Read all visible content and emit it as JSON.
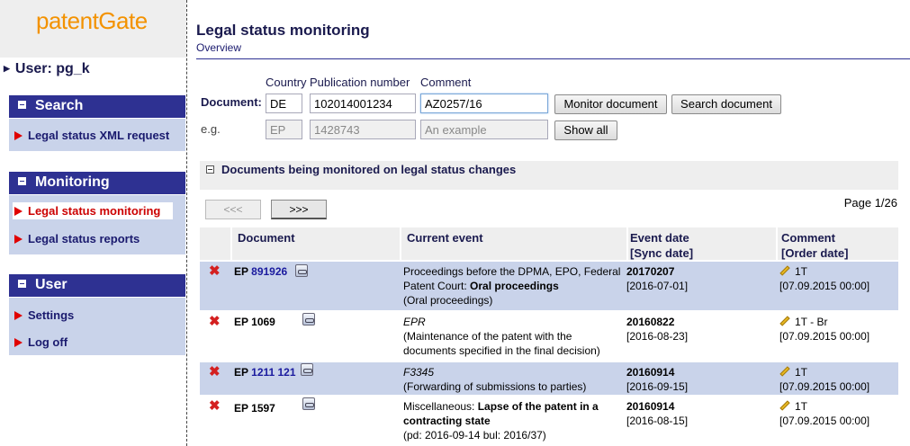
{
  "logo": "patentGate",
  "user_label": "User: pg_k",
  "sidebar": {
    "search": {
      "title": "Search",
      "items": [
        "Legal status XML request"
      ]
    },
    "monitoring": {
      "title": "Monitoring",
      "items": [
        "Legal status monitoring",
        "Legal status reports"
      ],
      "active": "Legal status monitoring"
    },
    "user": {
      "title": "User",
      "items": [
        "Settings",
        "Log off"
      ]
    }
  },
  "page": {
    "title": "Legal status monitoring",
    "subtitle": "Overview"
  },
  "form": {
    "document_label": "Document:",
    "eg_label": "e.g.",
    "country_label": "Country",
    "pubno_label": "Publication number",
    "comment_label": "Comment",
    "country_value": "DE",
    "pubno_value": "102014001234",
    "comment_value": "AZ0257/16",
    "country_example": "EP",
    "pubno_example": "1428743",
    "comment_example": "An example",
    "monitor_btn": "Monitor document",
    "search_btn": "Search document",
    "showall_btn": "Show all"
  },
  "monitored": {
    "title": "Documents being monitored on legal status changes",
    "prev": "<<<",
    "next": ">>>",
    "page_info": "Page 1/26",
    "headers": {
      "document": "Document",
      "event": "Current event",
      "date": "Event date",
      "sync": "[Sync date]",
      "comment": "Comment",
      "order": "[Order date]"
    },
    "rows": [
      {
        "doc_prefix": "EP",
        "doc_number": "891926",
        "linked": true,
        "event_pre": "Proceedings before the DPMA, EPO, Federal Patent Court: ",
        "event_bold": "Oral proceedings",
        "event_post": "(Oral proceedings)",
        "event_date": "20170207",
        "sync_date": "[2016-07-01]",
        "comment": "1T",
        "order_date": "[07.09.2015 00:00]"
      },
      {
        "doc_prefix": "EP",
        "doc_number": "1069",
        "linked": false,
        "event_code": "EPR",
        "event_desc": "(Maintenance of the patent with the documents specified in the final decision)",
        "event_date": "20160822",
        "sync_date": "[2016-08-23]",
        "comment": "1T - Br",
        "order_date": "[07.09.2015 00:00]"
      },
      {
        "doc_prefix": "EP",
        "doc_number": "1211 121",
        "linked": true,
        "event_code": "F3345",
        "event_desc": "(Forwarding of submissions to parties)",
        "event_date": "20160914",
        "sync_date": "[2016-09-15]",
        "comment": "1T",
        "order_date": "[07.09.2015 00:00]"
      },
      {
        "doc_prefix": "EP",
        "doc_number": "1597",
        "linked": false,
        "event_pre": "Miscellaneous: ",
        "event_bold": "Lapse of the patent in a contracting state",
        "event_post": "(pd: 2016-09-14 bul: 2016/37)",
        "event_date": "20160914",
        "sync_date": "[2016-08-15]",
        "comment": "1T",
        "order_date": "[07.09.2015 00:00]"
      }
    ]
  },
  "colors": {
    "nav_header": "#2e3192",
    "nav_panel": "#c9d3ea",
    "logo": "#f39200",
    "delete": "#d42020",
    "active_item": "#cc0000"
  }
}
